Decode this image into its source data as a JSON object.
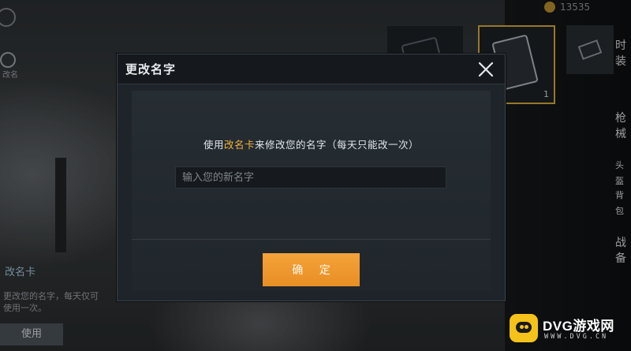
{
  "dialog": {
    "title": "更改名字",
    "prompt_prefix": "使用",
    "prompt_highlight": "改名卡",
    "prompt_suffix": "来修改您的名字（每天只能改一次）",
    "input_value": "",
    "input_placeholder": "输入您的新名字",
    "confirm_label": "确 定",
    "highlight_color": "#f2b43a",
    "confirm_color": "#f09a30"
  },
  "background": {
    "currency_amount": "13535",
    "side_label": "改名",
    "item_count": "1",
    "right_labels": [
      "时",
      "装",
      "枪",
      "械",
      "头",
      "盔",
      "背",
      "包",
      "战",
      "备"
    ],
    "left_panel": {
      "title": "改名卡",
      "description": "更改您的名字，每天仅可使用一次。",
      "use_button": "使用"
    }
  },
  "watermark": {
    "name": "DVG游戏网",
    "url": "WWW.DVG.CN"
  }
}
